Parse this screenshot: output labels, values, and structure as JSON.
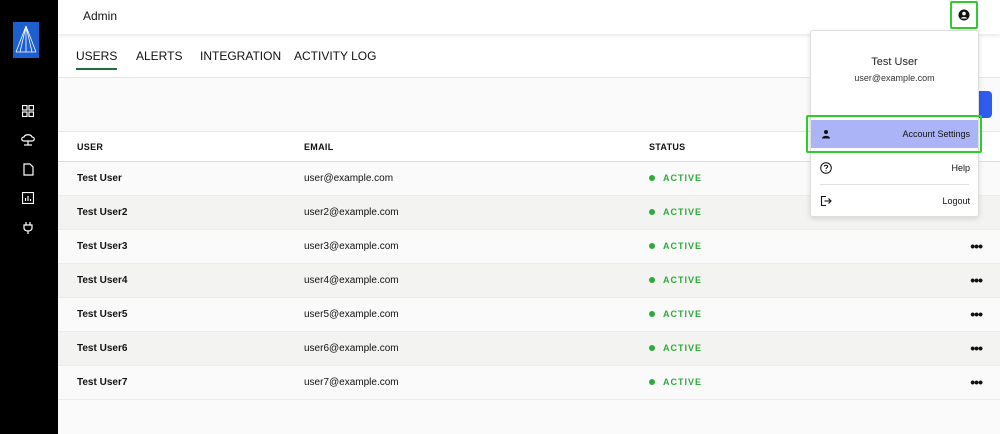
{
  "header": {
    "title": "Admin"
  },
  "tabs": [
    {
      "label": "USERS",
      "active": true
    },
    {
      "label": "ALERTS",
      "active": false
    },
    {
      "label": "INTEGRATION",
      "active": false
    },
    {
      "label": "ACTIVITY LOG",
      "active": false
    }
  ],
  "table": {
    "columns": {
      "user": "USER",
      "email": "EMAIL",
      "status": "STATUS"
    },
    "rows": [
      {
        "user": "Test User",
        "email": "user@example.com",
        "status": "ACTIVE"
      },
      {
        "user": "Test User2",
        "email": "user2@example.com",
        "status": "ACTIVE"
      },
      {
        "user": "Test User3",
        "email": "user3@example.com",
        "status": "ACTIVE"
      },
      {
        "user": "Test User4",
        "email": "user4@example.com",
        "status": "ACTIVE"
      },
      {
        "user": "Test User5",
        "email": "user5@example.com",
        "status": "ACTIVE"
      },
      {
        "user": "Test User6",
        "email": "user6@example.com",
        "status": "ACTIVE"
      },
      {
        "user": "Test User7",
        "email": "user7@example.com",
        "status": "ACTIVE"
      }
    ],
    "more_glyph": "•••"
  },
  "dropdown": {
    "name": "Test User",
    "email": "user@example.com",
    "items": [
      {
        "label": "Account Settings",
        "icon": "person-icon"
      },
      {
        "label": "Help",
        "icon": "help-icon"
      },
      {
        "label": "Logout",
        "icon": "logout-icon"
      }
    ]
  },
  "sidebar": {
    "icons": [
      "dashboard-icon",
      "cloud-network-icon",
      "document-icon",
      "report-icon",
      "plug-icon"
    ]
  },
  "colors": {
    "sidebar": "#000000",
    "status_active": "#2eaa3a",
    "accent_blue": "#2f5bf0",
    "highlight": "#aab4f7",
    "focus_outline": "#2ecc2e"
  }
}
